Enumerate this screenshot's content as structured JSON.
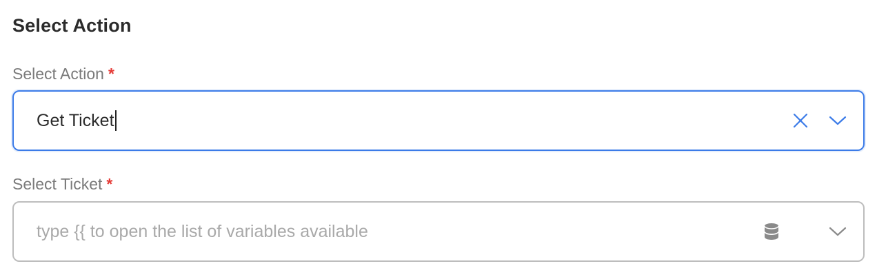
{
  "section": {
    "title": "Select Action"
  },
  "action_field": {
    "label": "Select Action",
    "required_mark": "*",
    "value": "Get Ticket"
  },
  "ticket_field": {
    "label": "Select Ticket",
    "required_mark": "*",
    "placeholder": "type {{ to open the list of variables available"
  },
  "icons": {
    "clear": "close-icon",
    "dropdown": "chevron-down-icon",
    "variables": "database-icon"
  },
  "colors": {
    "focus_border": "#3b7be8",
    "required": "#e53935",
    "idle_border": "#bdbdbd"
  }
}
